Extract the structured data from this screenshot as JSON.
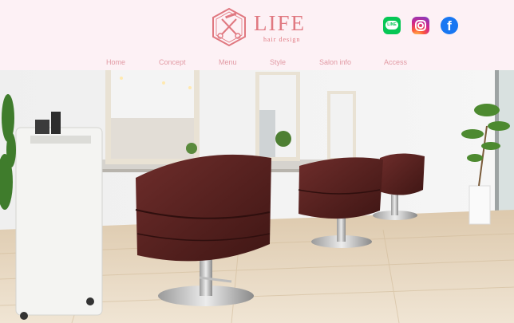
{
  "logo": {
    "title": "LIFE",
    "subtitle": "hair design",
    "color": "#e07880"
  },
  "social": [
    {
      "name": "line",
      "label": "LINE",
      "color": "#06c755"
    },
    {
      "name": "instagram",
      "color": "#d1258b"
    },
    {
      "name": "facebook",
      "label": "f",
      "color": "#1877f2"
    }
  ],
  "nav": [
    {
      "label": "Home"
    },
    {
      "label": "Concept"
    },
    {
      "label": "Menu"
    },
    {
      "label": "Style"
    },
    {
      "label": "Salon info"
    },
    {
      "label": "Access"
    }
  ],
  "hero": {
    "icon": "salon-interior-photo"
  },
  "colors": {
    "header_bg": "#fdf1f5",
    "nav_text": "#e29aa4",
    "chair": "#5a2424"
  }
}
